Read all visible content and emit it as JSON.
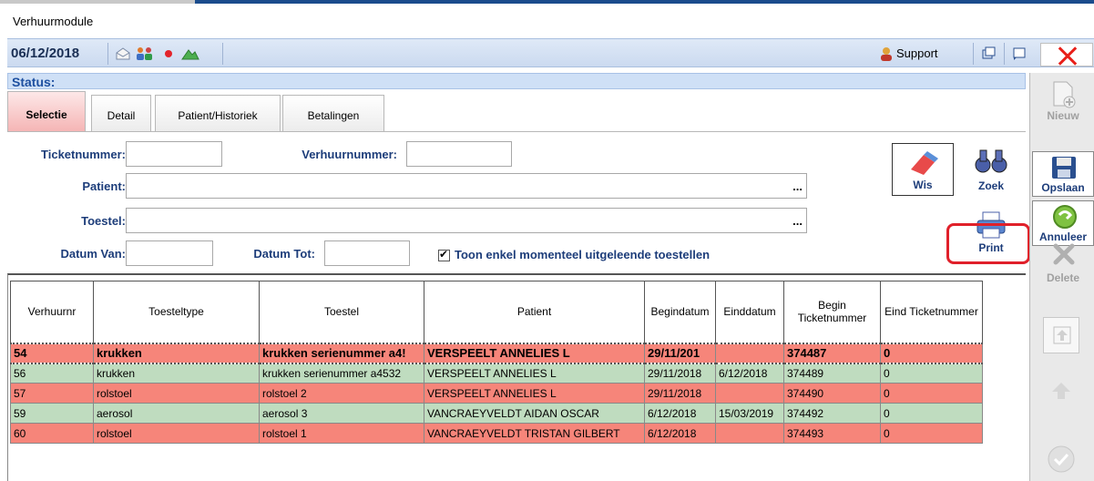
{
  "window": {
    "title": "Verhuurmodule"
  },
  "toolbar": {
    "date": "06/12/2018",
    "support_label": "Support"
  },
  "status": {
    "label": "Status:"
  },
  "tabs": [
    {
      "label": "Selectie",
      "active": true
    },
    {
      "label": "Detail",
      "active": false
    },
    {
      "label": "Patient/Historiek",
      "active": false
    },
    {
      "label": "Betalingen",
      "active": false
    }
  ],
  "form": {
    "ticketnummer_label": "Ticketnummer:",
    "verhuurnummer_label": "Verhuurnummer:",
    "patient_label": "Patient:",
    "toestel_label": "Toestel:",
    "datum_van_label": "Datum Van:",
    "datum_tot_label": "Datum Tot:",
    "checkbox_label": "Toon enkel momenteel uitgeleende toestellen",
    "checkbox_checked": true,
    "ellipsis": "...",
    "ticketnummer_value": "",
    "verhuurnummer_value": "",
    "patient_value": "",
    "toestel_value": "",
    "datum_van_value": "",
    "datum_tot_value": ""
  },
  "actions": {
    "wis": "Wis",
    "zoek": "Zoek",
    "print": "Print"
  },
  "grid": {
    "columns": [
      "Verhuurnr",
      "Toesteltype",
      "Toestel",
      "Patient",
      "Begindatum",
      "Einddatum",
      "Begin Ticketnummer",
      "Eind Ticketnummer"
    ],
    "rows": [
      {
        "color": "red",
        "selected": true,
        "cells": [
          "54",
          "krukken",
          "krukken serienummer a4!",
          "VERSPEELT ANNELIES L",
          "29/11/201",
          "",
          "374487",
          "0"
        ]
      },
      {
        "color": "green",
        "selected": false,
        "cells": [
          "56",
          "krukken",
          "krukken serienummer a4532",
          "VERSPEELT ANNELIES L",
          "29/11/2018",
          "6/12/2018",
          "374489",
          "0"
        ]
      },
      {
        "color": "red",
        "selected": false,
        "cells": [
          "57",
          "rolstoel",
          "rolstoel 2",
          "VERSPEELT ANNELIES L",
          "29/11/2018",
          "",
          "374490",
          "0"
        ]
      },
      {
        "color": "green",
        "selected": false,
        "cells": [
          "59",
          "aerosol",
          "aerosol 3",
          "VANCRAEYVELDT AIDAN OSCAR",
          "6/12/2018",
          "15/03/2019",
          "374492",
          "0"
        ]
      },
      {
        "color": "red",
        "selected": false,
        "cells": [
          "60",
          "rolstoel",
          "rolstoel 1",
          "VANCRAEYVELDT TRISTAN GILBERT",
          "6/12/2018",
          "",
          "374493",
          "0"
        ]
      }
    ]
  },
  "sidebar": {
    "nieuw": "Nieuw",
    "opslaan": "Opslaan",
    "annuleer": "Annuleer",
    "delete": "Delete"
  },
  "colors": {
    "row_red": "#f6857a",
    "row_green": "#bfdcbf",
    "highlight": "#e0202a",
    "label_blue": "#1d3d7a"
  }
}
